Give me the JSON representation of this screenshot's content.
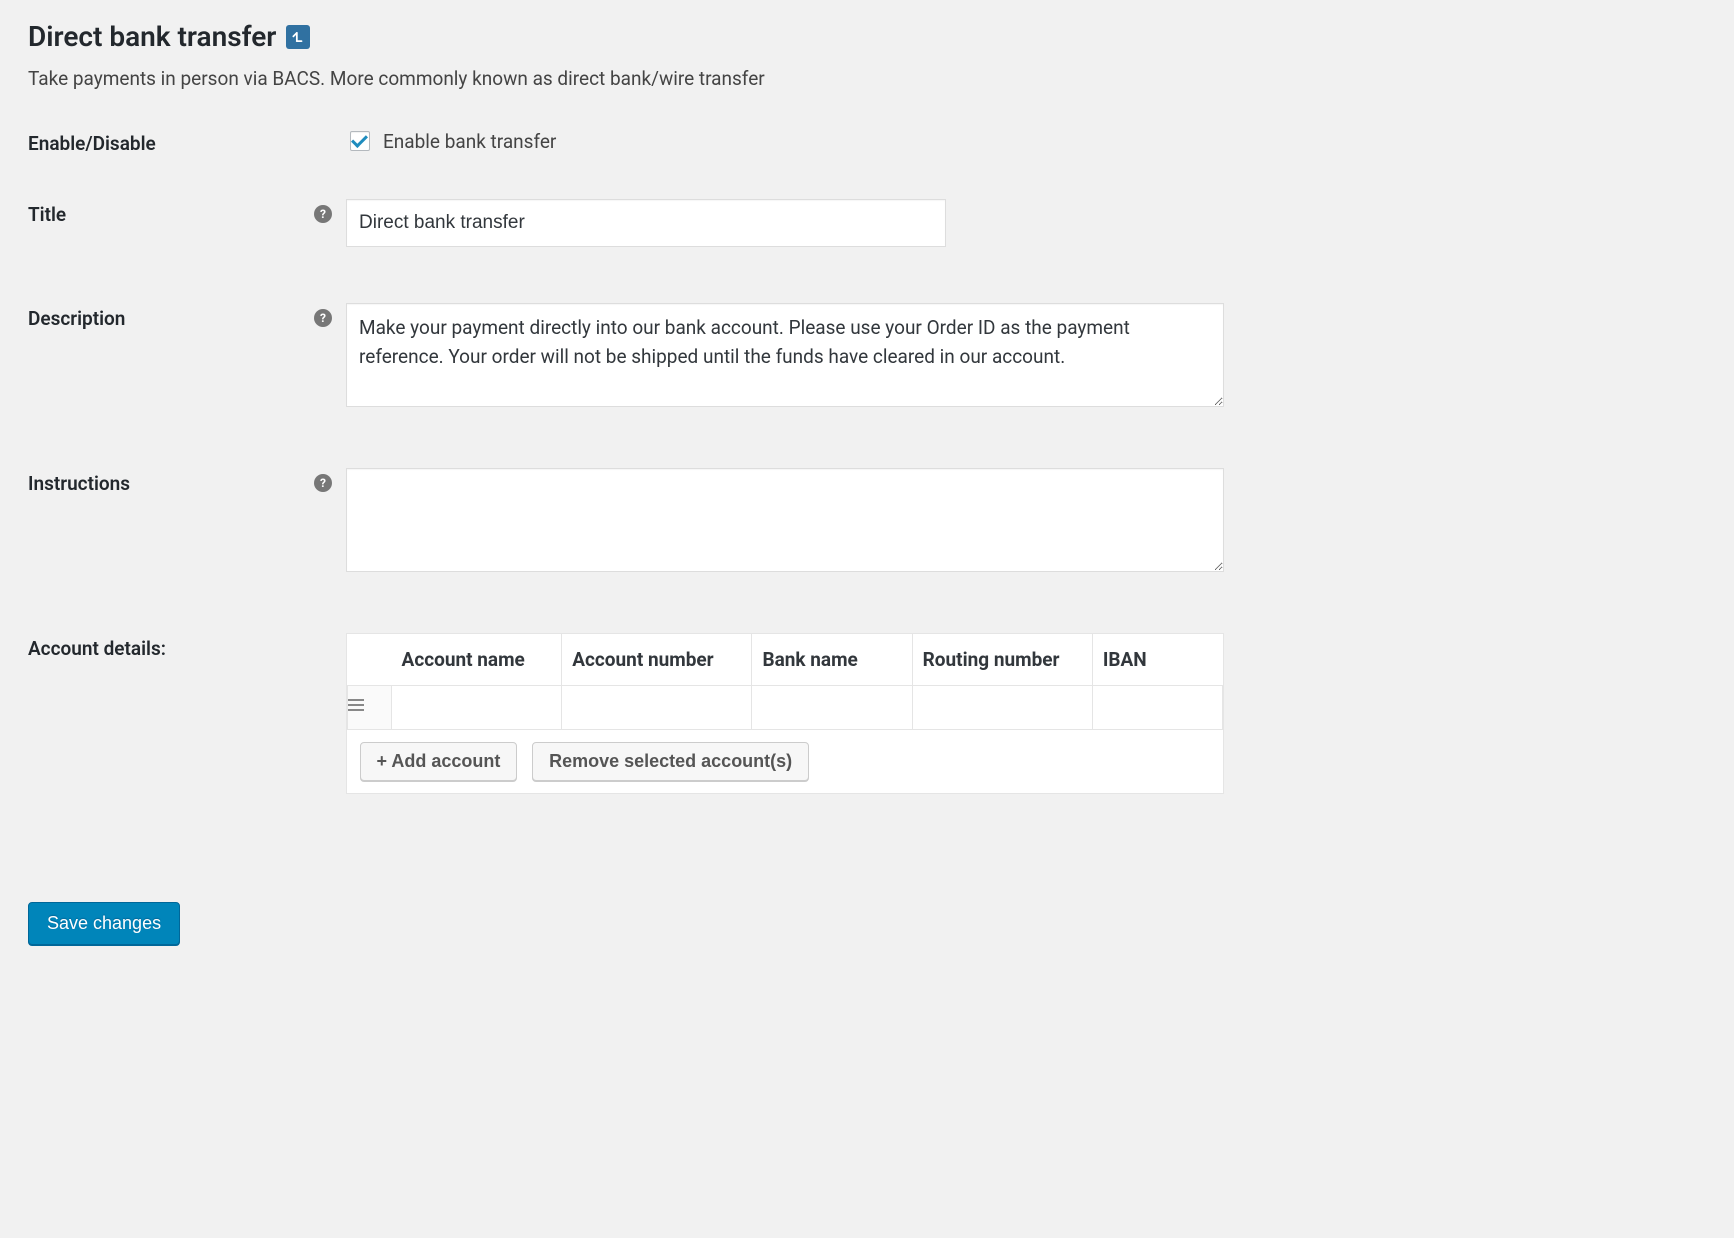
{
  "page": {
    "title": "Direct bank transfer",
    "subtitle": "Take payments in person via BACS. More commonly known as direct bank/wire transfer"
  },
  "labels": {
    "enable_disable": "Enable/Disable",
    "title": "Title",
    "description": "Description",
    "instructions": "Instructions",
    "account_details": "Account details:"
  },
  "fields": {
    "enable_checkbox_label": "Enable bank transfer",
    "enable_checked": true,
    "title_value": "Direct bank transfer",
    "description_value": "Make your payment directly into our bank account. Please use your Order ID as the payment reference. Your order will not be shipped until the funds have cleared in our account.",
    "instructions_value": ""
  },
  "accounts": {
    "columns": {
      "account_name": "Account name",
      "account_number": "Account number",
      "bank_name": "Bank name",
      "routing_number": "Routing number",
      "iban": "IBAN"
    },
    "rows": [
      {
        "account_name": "",
        "account_number": "",
        "bank_name": "",
        "routing_number": "",
        "iban": ""
      }
    ],
    "buttons": {
      "add": "+ Add account",
      "remove": "Remove selected account(s)"
    }
  },
  "actions": {
    "save": "Save changes"
  },
  "help_glyph": "?"
}
